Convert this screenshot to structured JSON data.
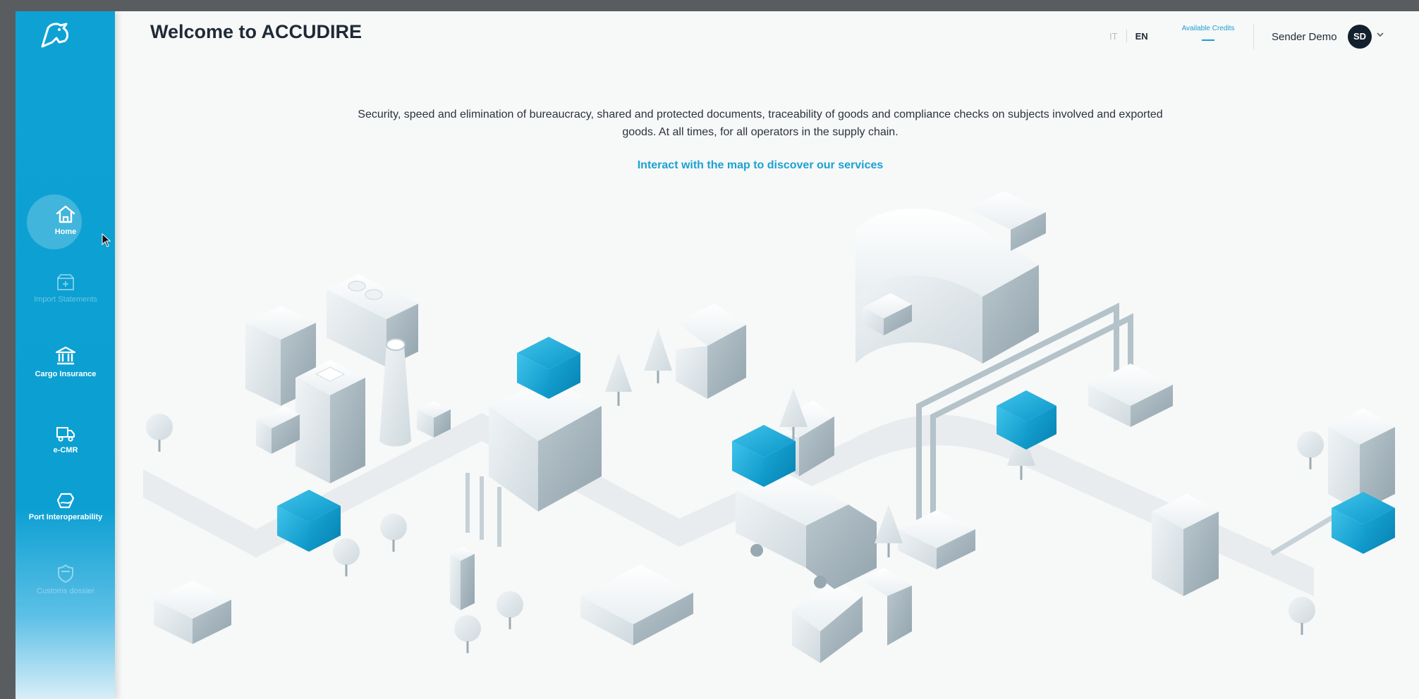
{
  "app": {
    "title": "Welcome to ACCUDIRE"
  },
  "colors": {
    "accent": "#0ea2d4",
    "dark": "#13202d",
    "link": "#1aa2d3"
  },
  "sidebar": {
    "logo_icon": "bird-logo-icon",
    "items": [
      {
        "label": "Home",
        "icon": "home-icon",
        "active": true,
        "enabled": true
      },
      {
        "label": "Import Statements",
        "icon": "box-icon",
        "active": false,
        "enabled": false
      },
      {
        "label": "Cargo Insurance",
        "icon": "bank-icon",
        "active": false,
        "enabled": true
      },
      {
        "label": "e-CMR",
        "icon": "truck-icon",
        "active": false,
        "enabled": true
      },
      {
        "label": "Port Interoperability",
        "icon": "ship-icon",
        "active": false,
        "enabled": true
      },
      {
        "label": "Customs dossier",
        "icon": "shield-icon",
        "active": false,
        "enabled": false
      }
    ]
  },
  "header": {
    "lang_it": "IT",
    "lang_en": "EN",
    "selected_language": "EN",
    "credits_label": "Available Credits",
    "user_name": "Sender Demo",
    "avatar_initials": "SD"
  },
  "main": {
    "intro": "Security, speed and elimination of bureaucracy, shared and protected documents, traceability of goods and compliance checks on subjects involved and exported goods. At all times, for all operators in the supply chain.",
    "cta": "Interact with the map to discover our services"
  }
}
